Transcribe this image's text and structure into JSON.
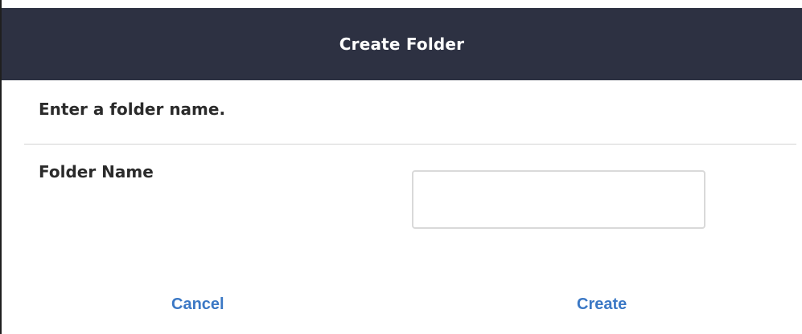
{
  "dialog": {
    "title": "Create Folder",
    "instruction": "Enter a folder name.",
    "field_label": "Folder Name",
    "input_value": "",
    "input_placeholder": "",
    "cancel_label": "Cancel",
    "create_label": "Create"
  },
  "colors": {
    "titlebar_bg": "#2d3142",
    "accent": "#3b78c5",
    "text": "#2b2b2b",
    "divider": "#d4d4d4"
  }
}
